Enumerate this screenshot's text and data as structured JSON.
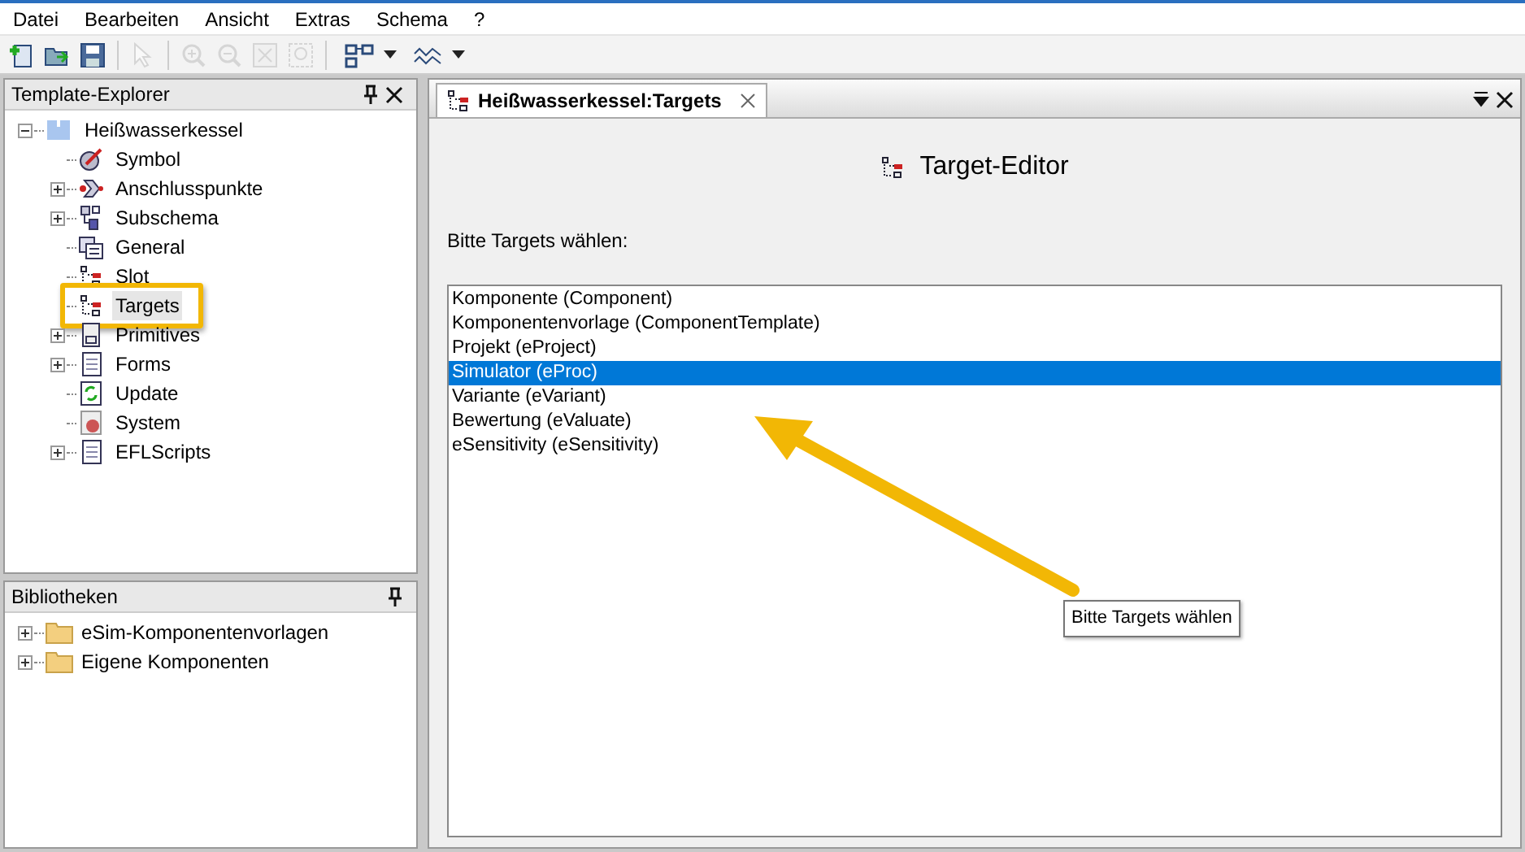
{
  "menu": [
    "Datei",
    "Bearbeiten",
    "Ansicht",
    "Extras",
    "Schema",
    "?"
  ],
  "toolbar": [
    {
      "kind": "new",
      "disabled": false
    },
    {
      "kind": "open",
      "disabled": false
    },
    {
      "kind": "save",
      "disabled": false
    },
    {
      "kind": "sep"
    },
    {
      "kind": "pointer",
      "disabled": true
    },
    {
      "kind": "sep"
    },
    {
      "kind": "zoomin",
      "disabled": true
    },
    {
      "kind": "zoomout",
      "disabled": true
    },
    {
      "kind": "fit",
      "disabled": true
    },
    {
      "kind": "zoombox",
      "disabled": true
    },
    {
      "kind": "sep"
    },
    {
      "kind": "layout",
      "disabled": false
    },
    {
      "kind": "dropdown",
      "disabled": false
    },
    {
      "kind": "wave",
      "disabled": false
    },
    {
      "kind": "dropdown",
      "disabled": false
    }
  ],
  "template_explorer": {
    "title": "Template-Explorer",
    "root": {
      "label": "Heißwasserkessel",
      "expanded": true,
      "children": [
        {
          "label": "Symbol",
          "kind": "symbol",
          "expandable": false,
          "selected": false
        },
        {
          "label": "Anschlusspunkte",
          "kind": "ports",
          "expandable": true,
          "selected": false
        },
        {
          "label": "Subschema",
          "kind": "subschema",
          "expandable": true,
          "selected": false
        },
        {
          "label": "General",
          "kind": "general",
          "expandable": false,
          "selected": false
        },
        {
          "label": "Slot",
          "kind": "targets",
          "expandable": false,
          "selected": false
        },
        {
          "label": "Targets",
          "kind": "targets",
          "expandable": false,
          "selected": true
        },
        {
          "label": "Primitives",
          "kind": "primitives",
          "expandable": true,
          "selected": false
        },
        {
          "label": "Forms",
          "kind": "script",
          "expandable": true,
          "selected": false
        },
        {
          "label": "Update",
          "kind": "update",
          "expandable": false,
          "selected": false
        },
        {
          "label": "System",
          "kind": "system",
          "expandable": false,
          "selected": false
        },
        {
          "label": "EFLScripts",
          "kind": "script",
          "expandable": true,
          "selected": false
        }
      ]
    }
  },
  "libraries": {
    "title": "Bibliotheken",
    "items": [
      {
        "label": "eSim-Komponentenvorlagen",
        "expandable": true
      },
      {
        "label": "Eigene Komponenten",
        "expandable": true
      }
    ]
  },
  "tab": {
    "label": "Heißwasserkessel:Targets",
    "selected": true
  },
  "editor": {
    "title": "Target-Editor",
    "prompt": "Bitte Targets wählen:",
    "targets": [
      {
        "label": "Komponente (Component)",
        "selected": false
      },
      {
        "label": "Komponentenvorlage (ComponentTemplate)",
        "selected": false
      },
      {
        "label": "Projekt (eProject)",
        "selected": false
      },
      {
        "label": "Simulator (eProc)",
        "selected": true
      },
      {
        "label": "Variante (eVariant)",
        "selected": false
      },
      {
        "label": "Bewertung (eValuate)",
        "selected": false
      },
      {
        "label": "eSensitivity (eSensitivity)",
        "selected": false
      }
    ],
    "tooltip": "Bitte Targets wählen"
  }
}
